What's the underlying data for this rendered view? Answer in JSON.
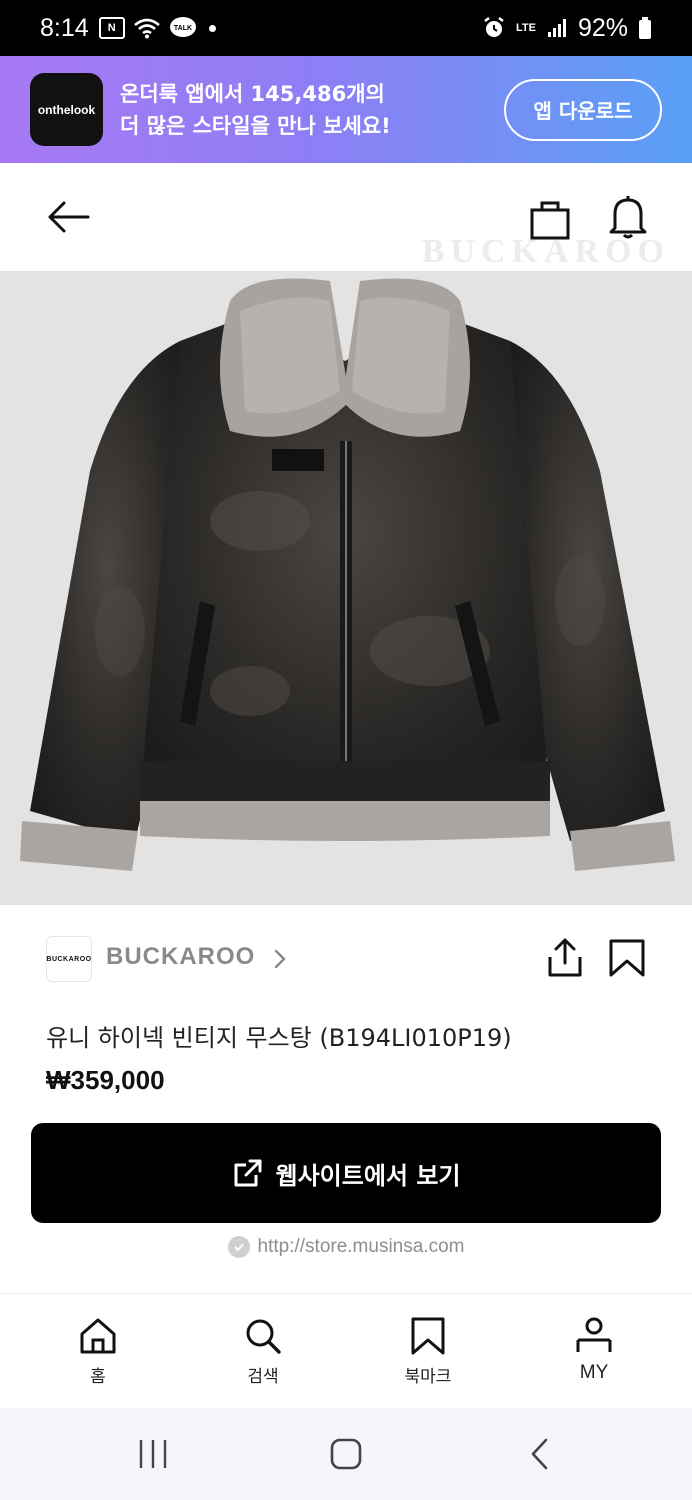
{
  "status_bar": {
    "time": "8:14",
    "lte": "LTE",
    "battery": "92%",
    "talk": "TALK"
  },
  "promo": {
    "logo_text": "onthelook",
    "line1": "온더룩 앱에서 145,486개의",
    "line2": "더 많은 스타일을 만나 보세요!",
    "button_label": "앱 다운로드"
  },
  "header": {
    "watermark": "BUCKAROO"
  },
  "brand": {
    "logo_text": "BUCKAROO",
    "name": "BUCKAROO"
  },
  "product": {
    "name": "유니 하이넥 빈티지 무스탕 (B194LI010P19)",
    "price": "₩359,000"
  },
  "cta": {
    "label": "웹사이트에서 보기",
    "url": "http://store.musinsa.com"
  },
  "bottom_nav": [
    {
      "label": "홈",
      "icon": "home-icon"
    },
    {
      "label": "검색",
      "icon": "search-icon"
    },
    {
      "label": "북마크",
      "icon": "bookmark-icon"
    },
    {
      "label": "MY",
      "icon": "user-icon"
    }
  ],
  "colors": {
    "banner_start": "#a779f4",
    "banner_end": "#5aa0f6",
    "cta_bg": "#000000"
  }
}
